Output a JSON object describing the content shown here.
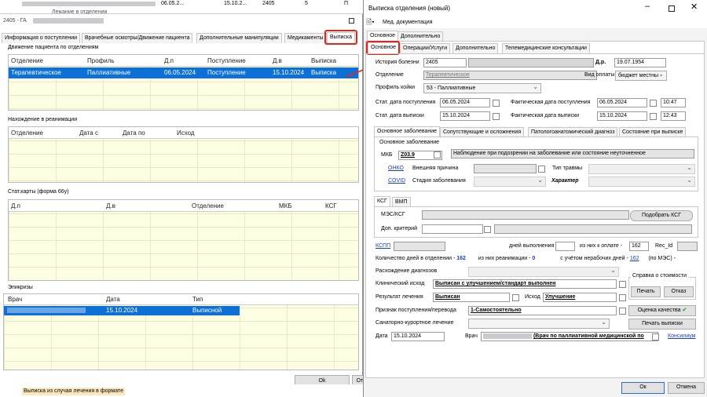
{
  "bg": {
    "top_rows": [
      [
        "06.05.2...",
        "15.10.2...",
        "2405",
        "5",
        "П"
      ],
      [
        "",
        "",
        "",
        "",
        ""
      ]
    ],
    "top_text": "Лежание в отделении",
    "title": "2405 - ГА",
    "tabs": [
      "Информация о поступлении",
      "Врачебные осмотры/Движение пациента",
      "Дополнительные манипуляции",
      "Медикаменты",
      "Выписка"
    ],
    "sec1": "Движение пациента по отделениям",
    "cols1": [
      "Отделение",
      "Профиль",
      "Д.п",
      "Поступление",
      "Д.в",
      "Выписка"
    ],
    "row1": [
      "Терапевтическое",
      "Паллиативные",
      "06.05.2024",
      "Поступление",
      "15.10.2024",
      "Выписка"
    ],
    "sec2": "Нахождение в реанимации",
    "cols2": [
      "Отделение",
      "Дата с",
      "Дата по",
      "Исход"
    ],
    "sec3": "Стат.карты (форма 66у)",
    "cols3": [
      "Д.п",
      "Д.в",
      "Отделение",
      "МКБ",
      "КСГ"
    ],
    "sec4": "Эпикризы",
    "cols4": [
      "Врач",
      "Дата",
      "Тип"
    ],
    "row4": [
      "",
      "15.10.2024",
      "Выписной"
    ],
    "ok": "Ok",
    "ot": "От",
    "bottom_text": "Выписка из случая лечения в формате"
  },
  "dlg": {
    "title": "Выписка отделения (новый)",
    "menu": "Мед. документация",
    "tabs_top": [
      "Основное",
      "Дополнительно"
    ],
    "tabs2": [
      "Основное",
      "Операции/Услуги",
      "Дополнительно",
      "Телемедицинские консультации"
    ],
    "history_label": "История болезни",
    "history_value": "2405",
    "dob_label": "Д.р.",
    "dob_value": "19.07.1954",
    "dept_label": "Отделение",
    "dept_value": "Терапевтическое",
    "pay_label": "Вид оплаты",
    "pay_value": "бюджет местны",
    "profile_label": "Профиль койки",
    "profile_value": "53 - Паллиативные",
    "stat_in_label": "Стат. дата поступления",
    "stat_in_value": "06.05.2024",
    "fact_in_label": "Фактическая дата поступления",
    "fact_in_date": "06.05.2024",
    "fact_in_time": "10:47",
    "stat_out_label": "Стат. дата выписки",
    "stat_out_value": "15.10.2024",
    "fact_out_label": "Фактическая дата выписки",
    "fact_out_date": "15.10.2024",
    "fact_out_time": "12:43",
    "diag_tabs": [
      "Основное заболевание",
      "Сопутствующие и осложнения",
      "Патологоанатомический диагноз",
      "Состояние при выписке"
    ],
    "diag_group": "Основное заболевание",
    "mkb_label": "МКБ",
    "mkb_value": "Z03.9",
    "mkb_desc": "Наблюдение при подозрении на заболевание или состояние неуточненное",
    "onko": "ОНКО",
    "ext_label": "Внешняя причина",
    "trauma_label": "Тип травмы",
    "covid": "COVID",
    "stage_label": "Стадия заболевания",
    "char_label": "Характер",
    "ksg_tabs": [
      "КСГ",
      "ВМП"
    ],
    "mes_label": "МЭС/КСГ",
    "pick_ksg": "Подобрать КСГ",
    "extra_crit": "Доп. критерий",
    "kspp": "КСПП",
    "days_exec": "дней выполнения -",
    "of_pay": "из них к оплате -",
    "of_pay_value": "162",
    "recid": "Rec_Id",
    "days_dept": "Количество дней в отделении -",
    "days_dept_value": "162",
    "reanim": "из них реанимации -",
    "reanim_value": "0",
    "nonwork": "с учётом нерабочих дней -",
    "nonwork_value": "162",
    "mes_note": "(по МЭС) -",
    "disc_label": "Расхождение диагнозов",
    "clin_label": "Клинический исход",
    "clin_value": "Выписан с улучшением/стандарт выполнен",
    "result_label": "Результат лечения",
    "result_value": "Выписан",
    "outcome_label": "Исход",
    "outcome_value": "Улучшение",
    "cost_group": "Справка о стоимости",
    "print": "Печать",
    "refuse": "Отказ",
    "sign_label": "Признак поступления/перевода",
    "sign_value": "1-Самостоятельно",
    "quality": "Оценка качества",
    "sanat_label": "Санаторно-курортное лечение",
    "print_out": "Печать выписки",
    "date_label": "Дата",
    "date_value": "15.10.2024",
    "doctor_label": "Врач",
    "doctor_value": "(Врач по паллиативной медицинской по",
    "konsilium": "Консилиум",
    "ok": "Ок",
    "cancel": "Отмена"
  },
  "colors": {
    "selection": "#0c70d6",
    "accent_red": "#e0251b",
    "link": "#1a40c0",
    "check_green": "#3aa63a"
  }
}
